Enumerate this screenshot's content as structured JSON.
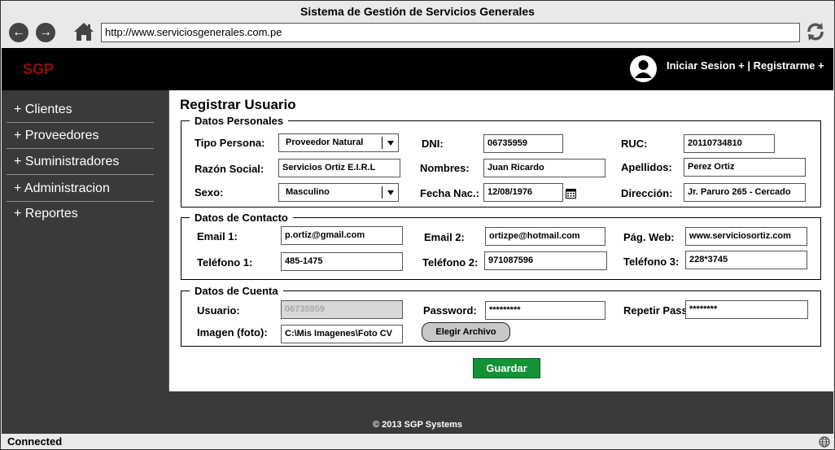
{
  "window": {
    "title": "Sistema de Gestión de Servicios Generales"
  },
  "browser": {
    "url": "http://www.serviciosgenerales.com.pe"
  },
  "header": {
    "logo": "SGP",
    "login": "Iniciar Sesion +",
    "separator": " | ",
    "register": "Registrarme +"
  },
  "sidebar": {
    "items": [
      {
        "label": "+ Clientes"
      },
      {
        "label": "+ Proveedores"
      },
      {
        "label": "+ Suministradores"
      },
      {
        "label": "+ Administracion"
      },
      {
        "label": "+ Reportes"
      }
    ]
  },
  "form": {
    "title": "Registrar Usuario",
    "personal": {
      "legend": "Datos Personales",
      "tipo_persona": {
        "label": "Tipo Persona:",
        "value": "Proveedor Natural"
      },
      "dni": {
        "label": "DNI:",
        "value": "06735959"
      },
      "ruc": {
        "label": "RUC:",
        "value": "20110734810"
      },
      "razon_social": {
        "label": "Razón Social:",
        "value": "Servicios Ortiz E.I.R.L"
      },
      "nombres": {
        "label": "Nombres:",
        "value": "Juan Ricardo"
      },
      "apellidos": {
        "label": "Apellidos:",
        "value": "Perez Ortiz"
      },
      "sexo": {
        "label": "Sexo:",
        "value": "Masculino"
      },
      "fecha_nac": {
        "label": "Fecha Nac.:",
        "value": "12/08/1976"
      },
      "direccion": {
        "label": "Dirección:",
        "value": "Jr. Paruro 265 - Cercado"
      }
    },
    "contacto": {
      "legend": "Datos de Contacto",
      "email1": {
        "label": "Email 1:",
        "value": "p.ortiz@gmail.com"
      },
      "email2": {
        "label": "Email 2:",
        "value": "ortizpe@hotmail.com"
      },
      "web": {
        "label": "Pág. Web:",
        "value": "www.serviciosortiz.com"
      },
      "tel1": {
        "label": "Teléfono 1:",
        "value": "485-1475"
      },
      "tel2": {
        "label": "Teléfono 2:",
        "value": "971087596"
      },
      "tel3": {
        "label": "Teléfono 3:",
        "value": "228*3745"
      }
    },
    "cuenta": {
      "legend": "Datos de Cuenta",
      "usuario": {
        "label": "Usuario:",
        "value": "06735959"
      },
      "password": {
        "label": "Password:",
        "value": "*********"
      },
      "repetir": {
        "label": "Repetir Pass:",
        "value": "********"
      },
      "imagen": {
        "label": "Imagen (foto):",
        "value": "C:\\Mis Imagenes\\Foto CV"
      },
      "choose_button": "Elegir Archivo"
    },
    "save_button": "Guardar"
  },
  "footer": {
    "copyright": "© 2013 SGP Systems"
  },
  "status": {
    "text": "Connected"
  },
  "colors": {
    "header_bg": "#000000",
    "logo": "#8b1010",
    "sidebar_bg": "#3a3a3a",
    "save_button": "#149237"
  }
}
